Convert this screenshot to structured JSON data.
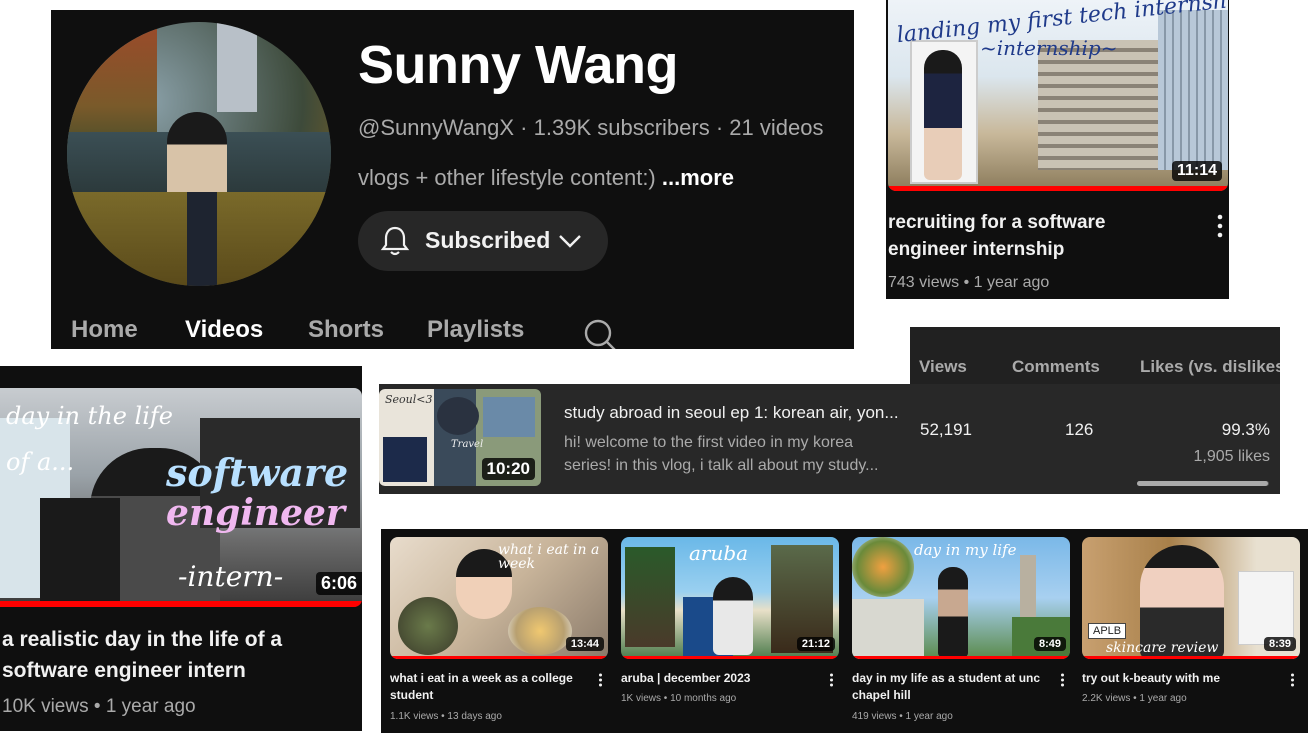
{
  "channel": {
    "name": "Sunny Wang",
    "handle": "@SunnyWangX",
    "subscribers": "1.39K subscribers",
    "videos": "21 videos",
    "separator": "·",
    "description": "vlogs + other lifestyle content:)",
    "more_label": "...more",
    "subscribe_label": "Subscribed",
    "tabs": [
      "Home",
      "Videos",
      "Shorts",
      "Playlists"
    ],
    "active_tab": "Videos"
  },
  "featured_video": {
    "title": "recruiting for a software engineer internship",
    "views": "743 views",
    "age": "1 year ago",
    "duration": "11:14",
    "thumb_text": "landing my first tech internship",
    "thumb_subtext": "~internship~",
    "progress": 1.0
  },
  "studio_row": {
    "columns": [
      "Views",
      "Comments",
      "Likes (vs. dislikes"
    ],
    "title": "study abroad in seoul ep 1: korean air, yon...",
    "description_line1": "hi! welcome to the first video in my korea",
    "description_line2": "series! in this vlog, i talk all about my study...",
    "duration": "10:20",
    "views": "52,191",
    "comments": "126",
    "likes_percent": "99.3%",
    "likes_count": "1,905 likes",
    "likes_ratio": 0.993,
    "thumb_text": "Seoul<3",
    "thumb_text2": "Travel"
  },
  "day_in_life_video": {
    "title_line1": "a realistic day in the life of a",
    "title_line2": "software engineer intern",
    "views": "10K views",
    "age": "1 year ago",
    "duration": "6:06",
    "thumb_line1": "day in the life",
    "thumb_line2": "of a...",
    "thumb_line3": "software",
    "thumb_line4": "engineer",
    "thumb_line5": "-intern-",
    "progress": 1.0
  },
  "video_grid": [
    {
      "title_line1": "what i eat in a week as a college",
      "title_line2": "student",
      "views": "1.1K views",
      "age": "13 days ago",
      "duration": "13:44",
      "thumb_text": "what i eat in a week",
      "progress": 1.0
    },
    {
      "title_line1": "aruba | december 2023",
      "title_line2": "",
      "views": "1K views",
      "age": "10 months ago",
      "duration": "21:12",
      "thumb_text": "aruba",
      "progress": 1.0
    },
    {
      "title_line1": "day in my life as a student at unc",
      "title_line2": "chapel hill",
      "views": "419 views",
      "age": "1 year ago",
      "duration": "8:49",
      "thumb_text": "day in my life",
      "progress": 1.0
    },
    {
      "title_line1": "try out k-beauty with me",
      "title_line2": "",
      "views": "2.2K views",
      "age": "1 year ago",
      "duration": "8:39",
      "thumb_text": "skincare review",
      "badge": "APLB",
      "progress": 1.0
    }
  ],
  "colors": {
    "background": "#0f0f0f",
    "progress": "#ff0000",
    "meta": "#aaaaaa"
  },
  "icons": [
    "bell-icon",
    "chevron-down-icon",
    "search-icon",
    "more-vert-icon"
  ]
}
